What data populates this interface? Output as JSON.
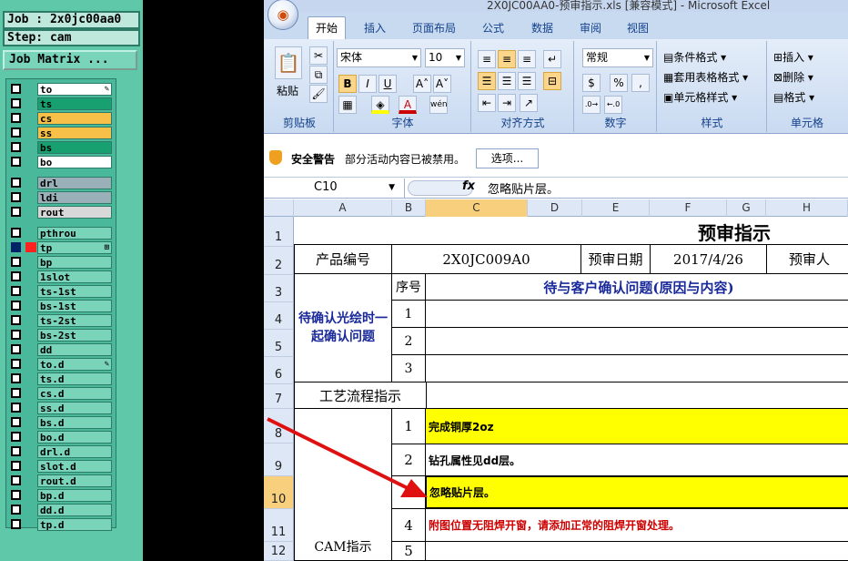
{
  "job_panel": {
    "job_label": "Job : 2x0jc00aa0",
    "step_label": "Step: cam",
    "matrix_button": "Job Matrix ...",
    "layers": [
      {
        "name": "to",
        "color": "#ffffff",
        "mark": "✎"
      },
      {
        "name": "ts",
        "color": "#18a070",
        "mark": ""
      },
      {
        "name": "cs",
        "color": "#f8c048",
        "mark": ""
      },
      {
        "name": "ss",
        "color": "#f8c048",
        "mark": ""
      },
      {
        "name": "bs",
        "color": "#18a070",
        "mark": ""
      },
      {
        "name": "bo",
        "color": "#ffffff",
        "mark": ""
      },
      {
        "name": "drl",
        "color": "#9ab0b8",
        "mark": ""
      },
      {
        "name": "ldi",
        "color": "#9ab0b8",
        "mark": ""
      },
      {
        "name": "rout",
        "color": "#d8d8d8",
        "mark": ""
      },
      {
        "name": "pthrou",
        "color": "#7ad4ba",
        "mark": ""
      },
      {
        "name": "tp",
        "color": "#7ad4ba",
        "mark": "⊞",
        "selected": true
      },
      {
        "name": "bp",
        "color": "#7ad4ba",
        "mark": ""
      },
      {
        "name": "1slot",
        "color": "#7ad4ba",
        "mark": ""
      },
      {
        "name": "ts-1st",
        "color": "#7ad4ba",
        "mark": ""
      },
      {
        "name": "bs-1st",
        "color": "#7ad4ba",
        "mark": ""
      },
      {
        "name": "ts-2st",
        "color": "#7ad4ba",
        "mark": ""
      },
      {
        "name": "bs-2st",
        "color": "#7ad4ba",
        "mark": ""
      },
      {
        "name": "dd",
        "color": "#7ad4ba",
        "mark": ""
      },
      {
        "name": "to.d",
        "color": "#7ad4ba",
        "mark": "✎"
      },
      {
        "name": "ts.d",
        "color": "#7ad4ba",
        "mark": ""
      },
      {
        "name": "cs.d",
        "color": "#7ad4ba",
        "mark": ""
      },
      {
        "name": "ss.d",
        "color": "#7ad4ba",
        "mark": ""
      },
      {
        "name": "bs.d",
        "color": "#7ad4ba",
        "mark": ""
      },
      {
        "name": "bo.d",
        "color": "#7ad4ba",
        "mark": ""
      },
      {
        "name": "drl.d",
        "color": "#7ad4ba",
        "mark": ""
      },
      {
        "name": "slot.d",
        "color": "#7ad4ba",
        "mark": ""
      },
      {
        "name": "rout.d",
        "color": "#7ad4ba",
        "mark": ""
      },
      {
        "name": "bp.d",
        "color": "#7ad4ba",
        "mark": ""
      },
      {
        "name": "dd.d",
        "color": "#7ad4ba",
        "mark": ""
      },
      {
        "name": "tp.d",
        "color": "#7ad4ba",
        "mark": ""
      }
    ]
  },
  "excel": {
    "window_title": "2X0JC00AA0-预审指示.xls [兼容模式] - Microsoft Excel",
    "tabs": [
      "开始",
      "插入",
      "页面布局",
      "公式",
      "数据",
      "审阅",
      "视图"
    ],
    "active_tab": "开始",
    "ribbon": {
      "clipboard": {
        "label": "剪贴板",
        "paste": "粘贴"
      },
      "font": {
        "label": "字体",
        "font_name": "宋体",
        "font_size": "10",
        "bold": "B",
        "italic": "I",
        "underline": "U"
      },
      "alignment": {
        "label": "对齐方式"
      },
      "number": {
        "label": "数字",
        "format": "常规",
        "percent": "%",
        "comma": ","
      },
      "styles": {
        "label": "样式",
        "conditional": "条件格式",
        "table": "套用表格格式",
        "cell_style": "单元格样式"
      },
      "cells": {
        "label": "单元格",
        "insert": "插入",
        "delete": "删除",
        "format": "格式"
      }
    },
    "security": {
      "title": "安全警告",
      "message": "部分活动内容已被禁用。",
      "options_button": "选项..."
    },
    "formula_bar": {
      "name_box": "C10",
      "fx": "fx",
      "formula": "忽略贴片层。"
    },
    "columns": [
      "A",
      "B",
      "C",
      "D",
      "E",
      "F",
      "G",
      "H"
    ],
    "rows": [
      "1",
      "2",
      "3",
      "4",
      "5",
      "6",
      "7",
      "8",
      "9",
      "10",
      "11",
      "12"
    ],
    "sheet": {
      "title": "预审指示",
      "product_label": "产品编号",
      "product_value": "2X0JC009A0",
      "date_label": "预审日期",
      "date_value": "2017/4/26",
      "reviewer_label": "预审人",
      "seq_label": "序号",
      "pending_header": "待与客户确认问题(原因与内容)",
      "pending_section": "待确认光绘时一起确认问题",
      "seq": [
        "1",
        "2",
        "3"
      ],
      "process_label": "工艺流程指示",
      "cam_label": "CAM指示",
      "cam_seq": [
        "1",
        "2",
        "3",
        "4",
        "5"
      ],
      "cam_items": [
        "完成铜厚2oz",
        "钻孔属性见dd层。",
        "忽略贴片层。",
        "附图位置无阻焊开窗，请添加正常的阻焊开窗处理。",
        ""
      ]
    }
  }
}
